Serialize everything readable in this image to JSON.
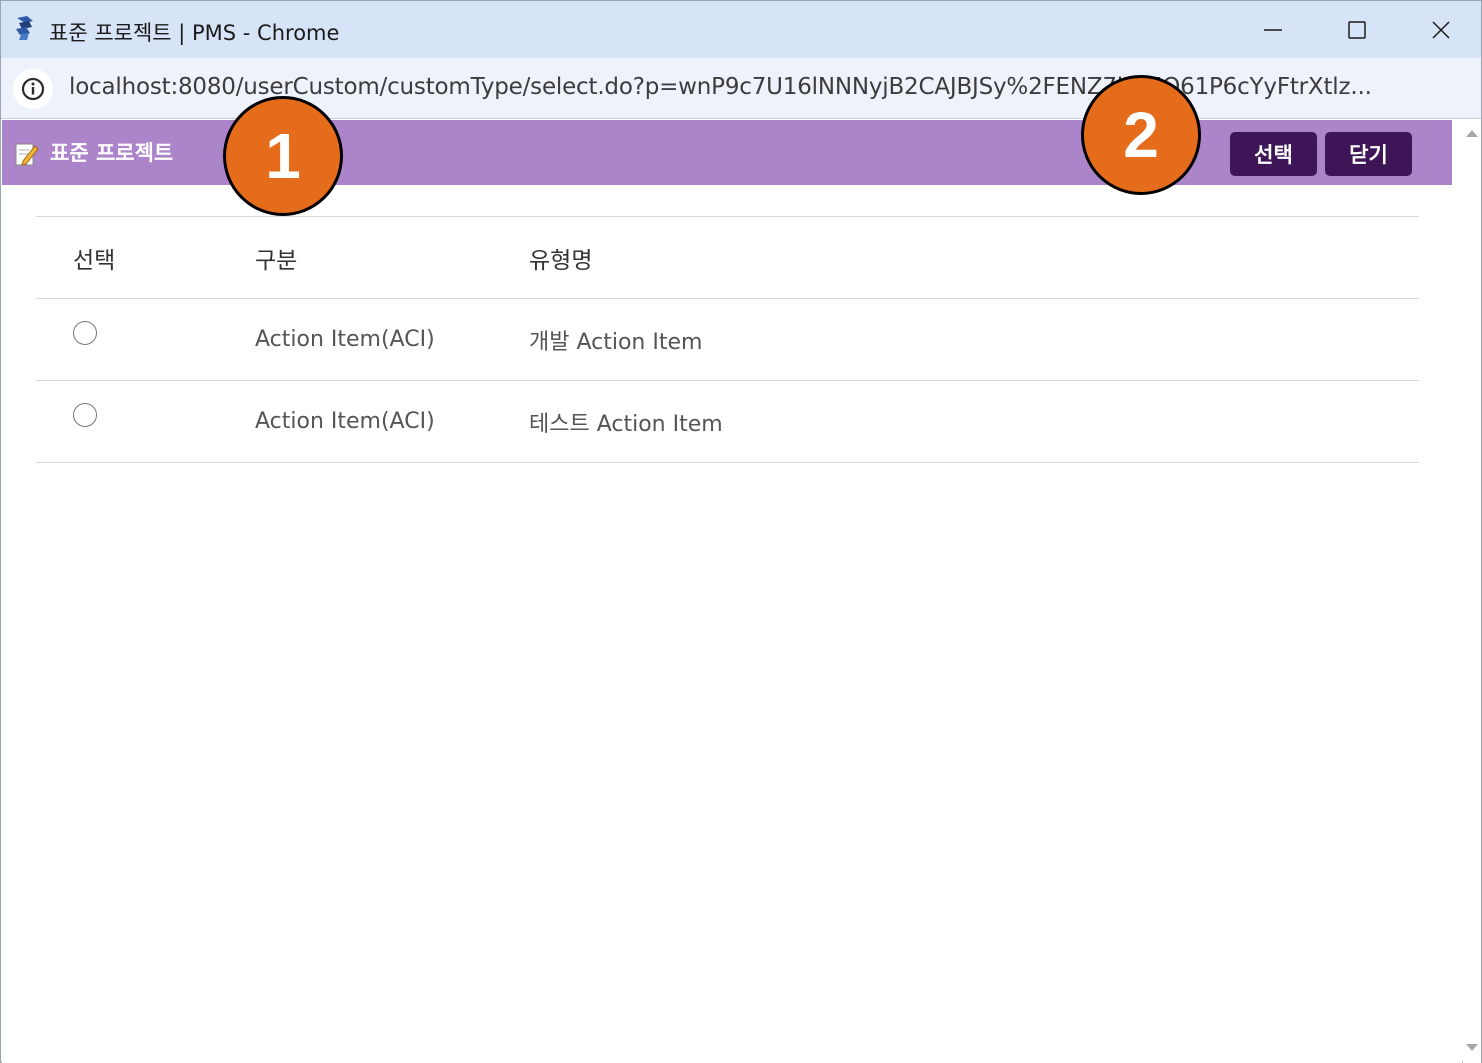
{
  "window": {
    "title": "표준 프로젝트 | PMS - Chrome",
    "url": "localhost:8080/userCustom/customType/select.do?p=wnP9c7U16lNNNyjB2CAJBJSy%2FENZ7kLMQ61P6cYyFtrXtlz..."
  },
  "popup": {
    "title": "표준 프로젝트",
    "buttons": {
      "select": "선택",
      "close": "닫기"
    }
  },
  "table": {
    "headers": [
      "선택",
      "구분",
      "유형명"
    ],
    "rows": [
      {
        "category": "Action Item(ACI)",
        "type_name": "개발 Action Item",
        "selected": false
      },
      {
        "category": "Action Item(ACI)",
        "type_name": "테스트 Action Item",
        "selected": false
      }
    ]
  },
  "annotations": {
    "callout_1": "1",
    "callout_2": "2",
    "color": "#e46c1b"
  },
  "colors": {
    "header_bg": "#ab84c9",
    "button_bg": "#3e1657",
    "titlebar_bg": "#d7e3f6"
  }
}
